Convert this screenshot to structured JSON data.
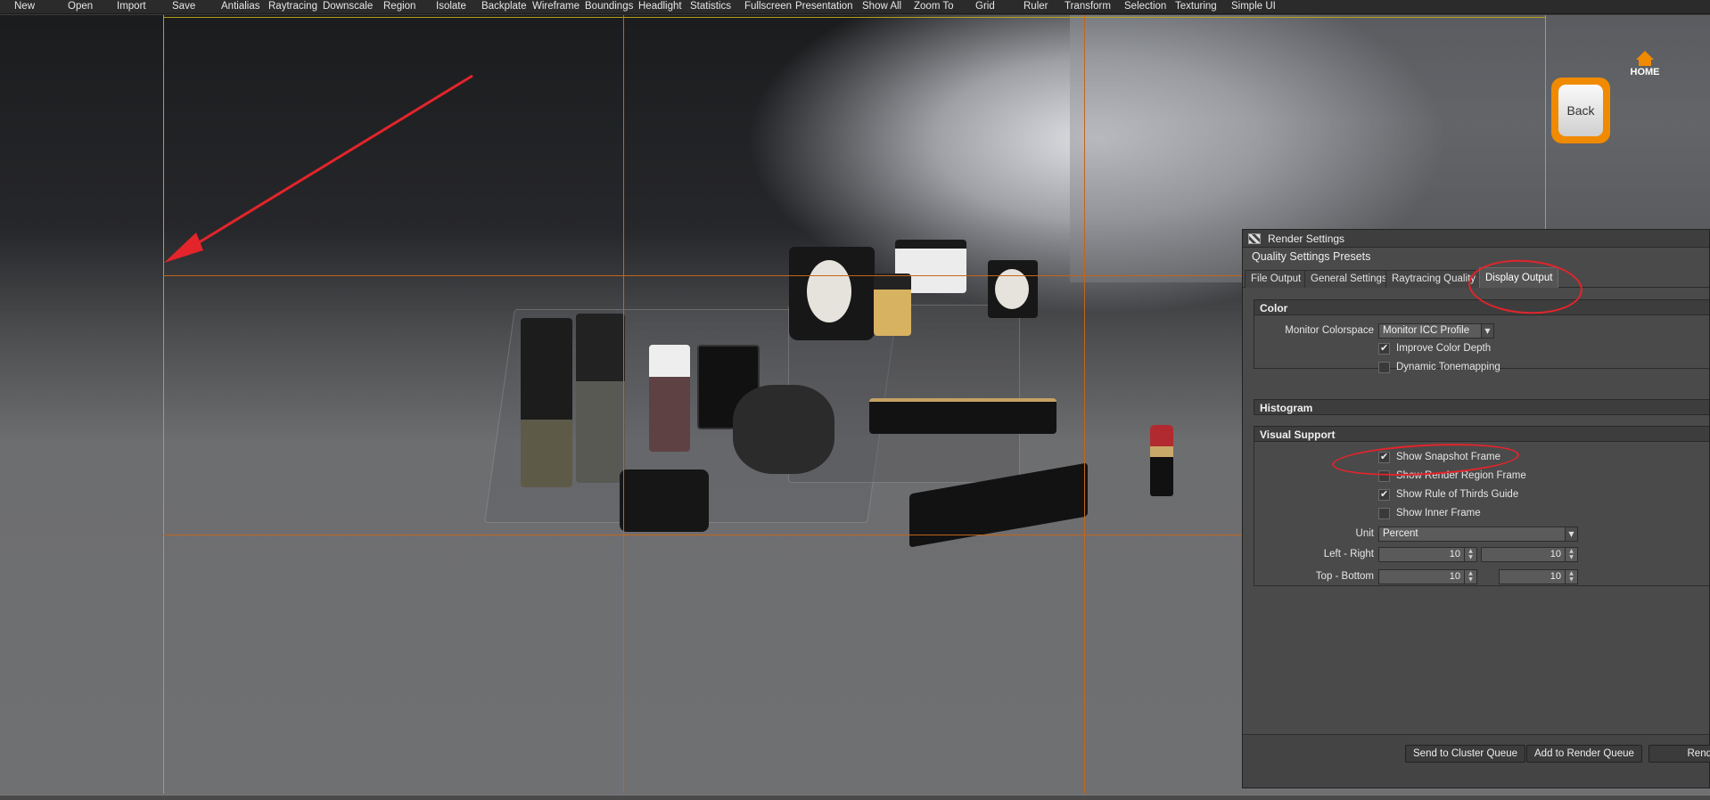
{
  "menu": {
    "items": [
      "New",
      "Open",
      "Import",
      "Save",
      "Antialias",
      "Raytracing",
      "Downscale",
      "Region",
      "Isolate",
      "Backplate",
      "Wireframe",
      "Boundings",
      "Headlight",
      "Statistics",
      "Fullscreen",
      "Presentation",
      "Show All",
      "Zoom To",
      "Grid",
      "Ruler",
      "Transform",
      "Selection",
      "Texturing",
      "Simple UI"
    ]
  },
  "nav": {
    "home_label": "HOME",
    "back_label": "Back",
    "home_color": "#f08a00"
  },
  "render_settings": {
    "title": "Render Settings",
    "presets_label": "Quality Settings Presets",
    "tabs": [
      "File Output",
      "General Settings",
      "Raytracing Quality",
      "Display Output"
    ],
    "active_tab": "Display Output",
    "color_section": {
      "header": "Color",
      "monitor_colorspace_label": "Monitor Colorspace",
      "monitor_colorspace_value": "Monitor ICC Profile",
      "improve_color_depth_label": "Improve Color Depth",
      "improve_color_depth_checked": true,
      "dynamic_tonemapping_label": "Dynamic Tonemapping",
      "dynamic_tonemapping_checked": false
    },
    "histogram_section": {
      "header": "Histogram"
    },
    "visual_support_section": {
      "header": "Visual Support",
      "show_snapshot_frame_label": "Show Snapshot Frame",
      "show_snapshot_frame_checked": true,
      "show_render_region_frame_label": "Show Render Region Frame",
      "show_render_region_frame_checked": false,
      "show_rule_of_thirds_label": "Show Rule of Thirds Guide",
      "show_rule_of_thirds_checked": true,
      "show_inner_frame_label": "Show Inner Frame",
      "show_inner_frame_checked": false,
      "unit_label": "Unit",
      "unit_value": "Percent",
      "left_right_label": "Left - Right",
      "left_value": "10",
      "right_value": "10",
      "top_bottom_label": "Top - Bottom",
      "top_value": "10",
      "bottom_value": "10"
    },
    "footer": {
      "send_to_cluster_label": "Send to Cluster Queue",
      "add_to_render_queue_label": "Add to Render Queue",
      "render_label": "Rend"
    }
  },
  "colors": {
    "snapshot_frame": "#b8a21a",
    "thirds_guide": "#c2661a",
    "annotation": "#e3242b"
  }
}
